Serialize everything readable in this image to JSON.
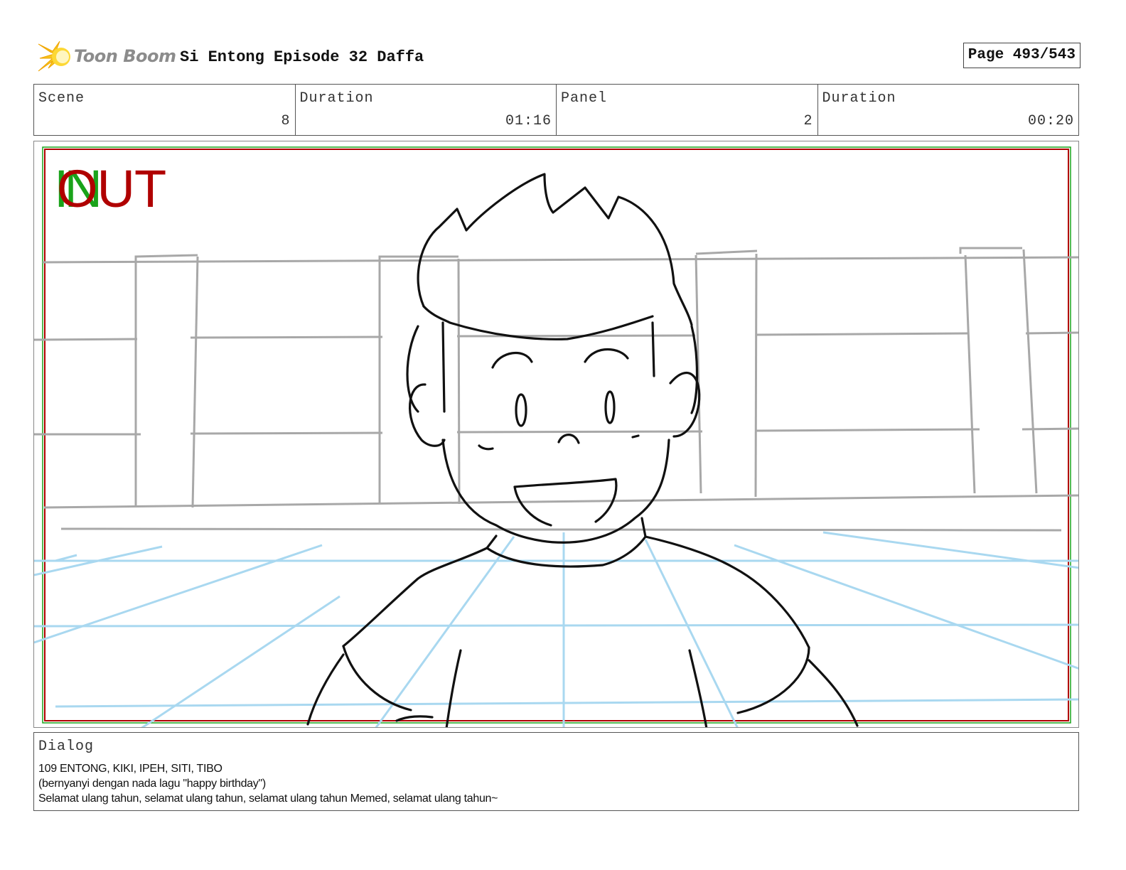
{
  "header": {
    "logo_text": "Toon Boom",
    "project_title": "Si Entong Episode 32 Daffa",
    "page_label": "Page 493/543"
  },
  "info": {
    "scene_label": "Scene",
    "scene_value": "8",
    "scene_duration_label": "Duration",
    "scene_duration_value": "01:16",
    "panel_label": "Panel",
    "panel_value": "2",
    "panel_duration_label": "Duration",
    "panel_duration_value": "00:20"
  },
  "panel": {
    "in_marker": "IN",
    "out_marker": "OUT",
    "colors": {
      "in": "#1aa31a",
      "out": "#b00000",
      "sketch": "#111111",
      "background_lines": "#a8a8a8",
      "floor_lines": "#a9d8f0"
    }
  },
  "dialog": {
    "label": "Dialog",
    "lines": [
      "109 ENTONG, KIKI, IPEH, SITI, TIBO",
      "(bernyanyi dengan nada lagu \"happy birthday\")",
      "Selamat ulang tahun, selamat ulang tahun, selamat ulang tahun Memed, selamat ulang tahun~"
    ]
  }
}
